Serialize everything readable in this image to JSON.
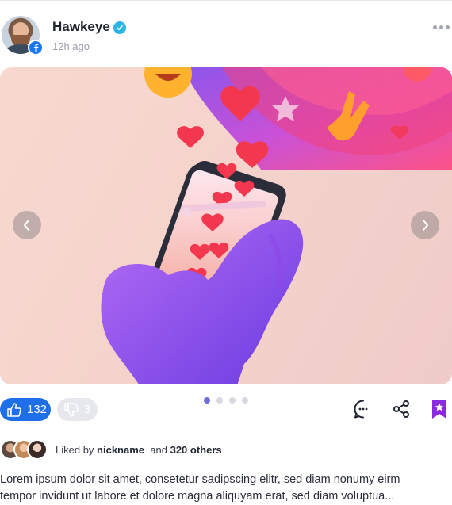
{
  "post": {
    "author": "Hawkeye",
    "time": "12h ago",
    "verified": true,
    "source_icon": "facebook-icon"
  },
  "carousel": {
    "slide_count": 4,
    "active_index": 0
  },
  "actions": {
    "likes": "132",
    "dislikes": "3"
  },
  "liked_by": {
    "prefix": "Liked by",
    "nickname": "nickname",
    "and": "and",
    "others": "320 others"
  },
  "caption": {
    "line1": "Lorem ipsum dolor sit amet, consetetur sadipscing elitr, sed diam nonumy eirm",
    "line2": "tempor invidunt ut labore et dolore magna aliquyam erat, sed diam voluptua..."
  },
  "colors": {
    "like_blue": "#1e6fe8",
    "bookmark_purple": "#8a2be2",
    "verified_teal": "#29b6e6",
    "facebook_blue": "#1877f2"
  }
}
